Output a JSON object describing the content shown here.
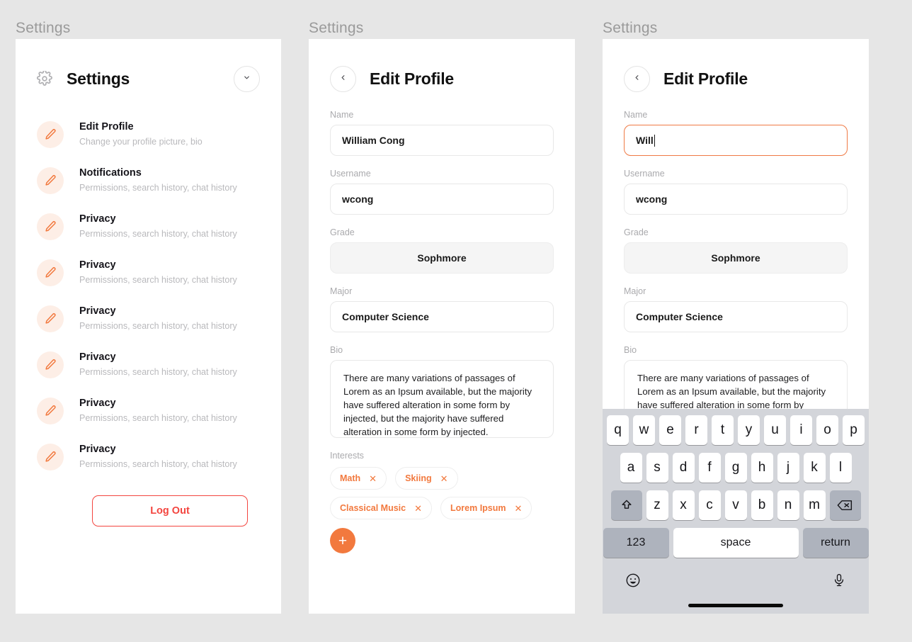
{
  "frames": [
    {
      "label": "Settings"
    },
    {
      "label": "Settings"
    },
    {
      "label": "Settings"
    }
  ],
  "colors": {
    "accent_orange": "#f2793e",
    "accent_orange_soft": "#fdeee6",
    "danger_red": "#f3453f",
    "page_background": "#e6e6e6",
    "panel_background": "#ffffff",
    "label_gray": "#aaaaad",
    "subtitle_gray": "#b9b9bc",
    "keyboard_background": "#d3d5da",
    "keyboard_mod_key": "#aeb3bd",
    "focus_border": "#ef7a45"
  },
  "settings_panel": {
    "gear_icon": "gear-icon",
    "title": "Settings",
    "collapse_icon": "chevron-down-icon",
    "items": [
      {
        "icon": "pencil-icon",
        "title": "Edit Profile",
        "subtitle": "Change your profile picture, bio"
      },
      {
        "icon": "pencil-icon",
        "title": "Notifications",
        "subtitle": "Permissions, search history, chat history"
      },
      {
        "icon": "pencil-icon",
        "title": "Privacy",
        "subtitle": "Permissions, search history, chat history"
      },
      {
        "icon": "pencil-icon",
        "title": "Privacy",
        "subtitle": "Permissions, search history, chat history"
      },
      {
        "icon": "pencil-icon",
        "title": "Privacy",
        "subtitle": "Permissions, search history, chat history"
      },
      {
        "icon": "pencil-icon",
        "title": "Privacy",
        "subtitle": "Permissions, search history, chat history"
      },
      {
        "icon": "pencil-icon",
        "title": "Privacy",
        "subtitle": "Permissions, search history, chat history"
      },
      {
        "icon": "pencil-icon",
        "title": "Privacy",
        "subtitle": "Permissions, search history, chat history"
      }
    ],
    "logout_label": "Log Out"
  },
  "edit_profile": {
    "back_icon": "chevron-left-icon",
    "title": "Edit Profile",
    "labels": {
      "name": "Name",
      "username": "Username",
      "grade": "Grade",
      "major": "Major",
      "bio": "Bio",
      "interests": "Interests"
    },
    "values": {
      "name": "William Cong",
      "username": "wcong",
      "grade": "Sophmore",
      "major": "Computer Science",
      "bio": "There are many variations of passages of Lorem as an Ipsum available, but the majority have suffered alteration in some form by injected, but the majority have suffered alteration in some form by injected."
    },
    "interests": [
      {
        "label": "Math",
        "remove_icon": "close-icon"
      },
      {
        "label": "Skiing",
        "remove_icon": "close-icon"
      },
      {
        "label": "Classical Music",
        "remove_icon": "close-icon"
      },
      {
        "label": "Lorem Ipsum",
        "remove_icon": "close-icon"
      }
    ],
    "add_interest_label": "+"
  },
  "edit_profile_editing": {
    "back_icon": "chevron-left-icon",
    "title": "Edit Profile",
    "labels": {
      "name": "Name",
      "username": "Username",
      "grade": "Grade",
      "major": "Major",
      "bio": "Bio"
    },
    "values": {
      "name": "Will",
      "username": "wcong",
      "grade": "Sophmore",
      "major": "Computer Science",
      "bio": "There are many variations of passages of Lorem as an Ipsum available, but the majority have suffered alteration in some form by injected, but the majority have suffered alteration in some form by injected."
    }
  },
  "keyboard": {
    "row1": [
      "q",
      "w",
      "e",
      "r",
      "t",
      "y",
      "u",
      "i",
      "o",
      "p"
    ],
    "row2": [
      "a",
      "s",
      "d",
      "f",
      "g",
      "h",
      "j",
      "k",
      "l"
    ],
    "row3": [
      "z",
      "x",
      "c",
      "v",
      "b",
      "n",
      "m"
    ],
    "shift_icon": "shift-icon",
    "backspace_icon": "backspace-icon",
    "numbers_label": "123",
    "space_label": "space",
    "return_label": "return",
    "emoji_icon": "emoji-icon",
    "microphone_icon": "microphone-icon"
  }
}
